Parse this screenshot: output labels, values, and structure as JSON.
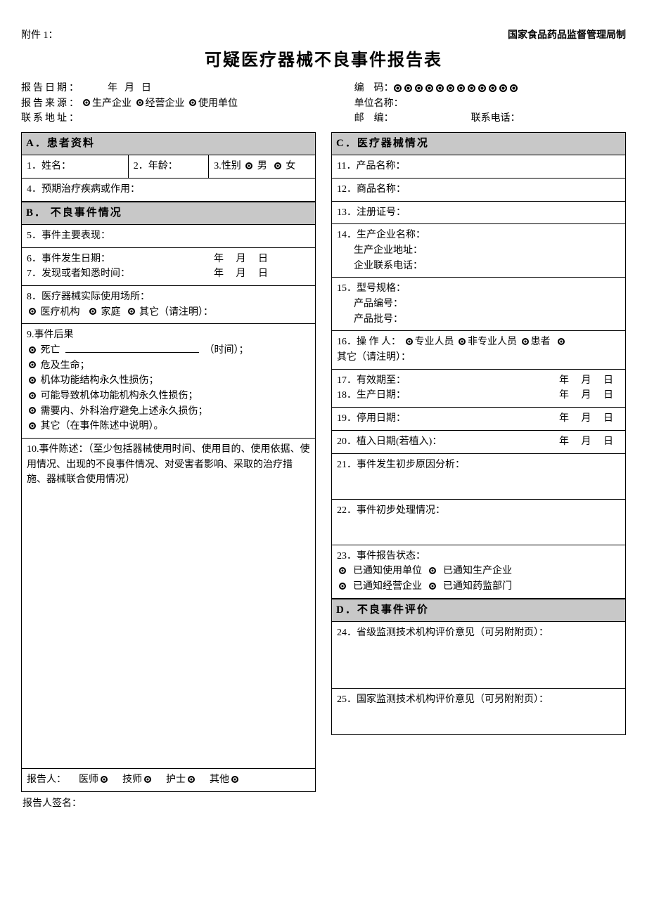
{
  "header": {
    "attachment": "附件 1：",
    "issuer": "国家食品药品监督管理局制",
    "title": "可疑医疗器械不良事件报告表"
  },
  "meta": {
    "report_date_label": "报告日期：",
    "date_y": "年",
    "date_m": "月",
    "date_d": "日",
    "source_label": "报告来源：",
    "source_opt1": "生产企业",
    "source_opt2": "经营企业",
    "source_opt3": "使用单位",
    "contact_addr_label": "联系地址：",
    "code_label": "编　码：",
    "unit_name_label": "单位名称：",
    "zip_label": "邮　编：",
    "phone_label": "联系电话："
  },
  "sectionA": {
    "head": "A．患者资料",
    "f1": "1．姓名：",
    "f2": "2．年龄：",
    "f3": "3.性别",
    "f3_m": "男",
    "f3_f": "女",
    "f4": "4．预期治疗疾病或作用："
  },
  "sectionB": {
    "head": "B． 不良事件情况",
    "f5": "5．事件主要表现：",
    "f6": "6．事件发生日期：",
    "f7": "7．发现或者知悉时间：",
    "date_ymd": "年　  月　 日",
    "f8": "8．医疗器械实际使用场所：",
    "f8_o1": "医疗机构",
    "f8_o2": "家庭",
    "f8_o3": "其它（请注明）：",
    "f9": "9.事件后果",
    "f9_o1": "死亡",
    "f9_o1_suffix": "（时间）；",
    "f9_o2": "危及生命；",
    "f9_o3": "机体功能结构永久性损伤；",
    "f9_o4": "可能导致机体功能机构永久性损伤；",
    "f9_o5": "需要内、外科治疗避免上述永久损伤；",
    "f9_o6": "其它（在事件陈述中说明）。",
    "f10": "10.事件陈述：（至少包括器械使用时间、使用目的、使用依据、使用情况、出现的不良事件情况、对受害者影响、采取的治疗措施、器械联合使用情况）",
    "reporter_label": "报告人：",
    "rp_o1": "医师",
    "rp_o2": "技师",
    "rp_o3": "护士",
    "rp_o4": "其他"
  },
  "sectionC": {
    "head": "C．医疗器械情况",
    "f11": "11．产品名称：",
    "f12": "12．商品名称：",
    "f13": "13．注册证号：",
    "f14a": "14．生产企业名称：",
    "f14b": "生产企业地址：",
    "f14c": "企业联系电话：",
    "f15a": "15．型号规格：",
    "f15b": "产品编号：",
    "f15c": "产品批号：",
    "f16": "16．操 作 人：",
    "f16_o1": "专业人员",
    "f16_o2": "非专业人员",
    "f16_o3": "患者",
    "f16_o4_prefix": "其它（请注明）：",
    "f17": "17．有效期至：",
    "f18": "18．生产日期：",
    "f19": "19．停用日期：",
    "f20": "20．植入日期(若植入)：",
    "date_ymd_wide": "年　  月　  日",
    "f21": "21．事件发生初步原因分析：",
    "f22": "22．事件初步处理情况：",
    "f23": "23．事件报告状态：",
    "f23_o1": "已通知使用单位",
    "f23_o2": "已通知生产企业",
    "f23_o3": "已通知经营企业",
    "f23_o4": "已通知药监部门"
  },
  "sectionD": {
    "head": "D．不良事件评价",
    "f24": "24．省级监测技术机构评价意见（可另附附页）：",
    "f25": "25．国家监测技术机构评价意见（可另附附页）："
  },
  "footer": {
    "signature": "报告人签名："
  }
}
